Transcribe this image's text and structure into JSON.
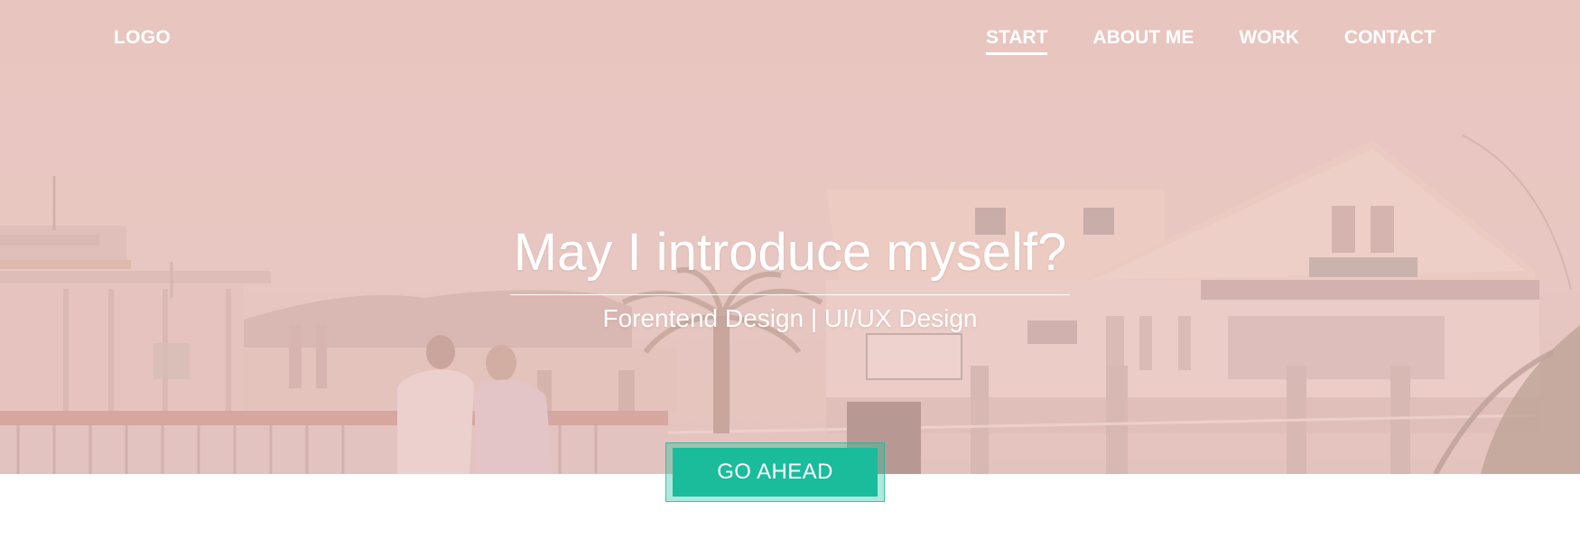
{
  "header": {
    "logo": "LOGO",
    "nav": [
      {
        "label": "START",
        "active": true
      },
      {
        "label": "ABOUT ME",
        "active": false
      },
      {
        "label": "WORK",
        "active": false
      },
      {
        "label": "CONTACT",
        "active": false
      }
    ]
  },
  "hero": {
    "title": "May I introduce myself?",
    "subtitle": "Forentend Design | UI/UX Design",
    "cta_label": "GO AHEAD",
    "background_image": "harbour pier with couple sitting on railing, pastel pink tint"
  },
  "colors": {
    "accent": "#1abc9c",
    "overlay": "#e8c8c2",
    "text": "#ffffff"
  }
}
